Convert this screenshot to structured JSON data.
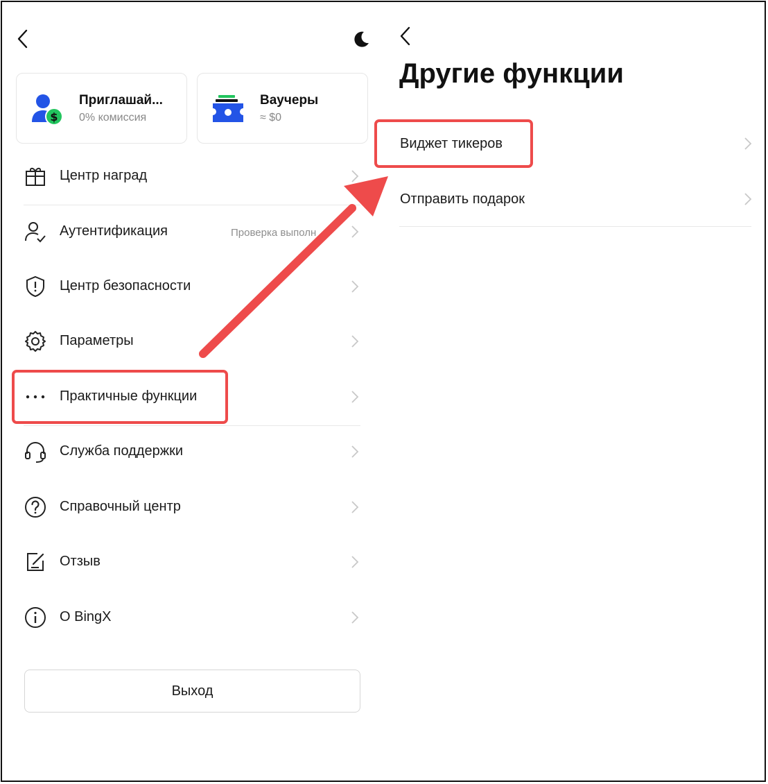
{
  "left_panel": {
    "cards": {
      "invite": {
        "title": "Приглашай...",
        "subtitle": "0% комиссия"
      },
      "voucher": {
        "title": "Ваучеры",
        "subtitle": "≈ $0"
      }
    },
    "menu": [
      {
        "label": "Центр наград",
        "icon": "gift-icon"
      },
      {
        "label": "Аутентификация",
        "icon": "user-check-icon",
        "hint": "Проверка выполн"
      },
      {
        "label": "Центр безопасности",
        "icon": "shield-icon"
      },
      {
        "label": "Параметры",
        "icon": "gear-icon"
      },
      {
        "label": "Практичные функции",
        "icon": "more-dots-icon"
      },
      {
        "label": "Служба поддержки",
        "icon": "headset-icon"
      },
      {
        "label": "Справочный центр",
        "icon": "question-icon"
      },
      {
        "label": "Отзыв",
        "icon": "edit-icon"
      },
      {
        "label": "О BingX",
        "icon": "info-icon"
      }
    ],
    "logout_label": "Выход"
  },
  "right_panel": {
    "title": "Другие функции",
    "items": [
      {
        "label": "Виджет тикеров"
      },
      {
        "label": "Отправить подарок"
      }
    ]
  },
  "colors": {
    "annotation_red": "#ee4b4b",
    "brand_blue": "#2354e6",
    "accent_green": "#22c55e"
  }
}
